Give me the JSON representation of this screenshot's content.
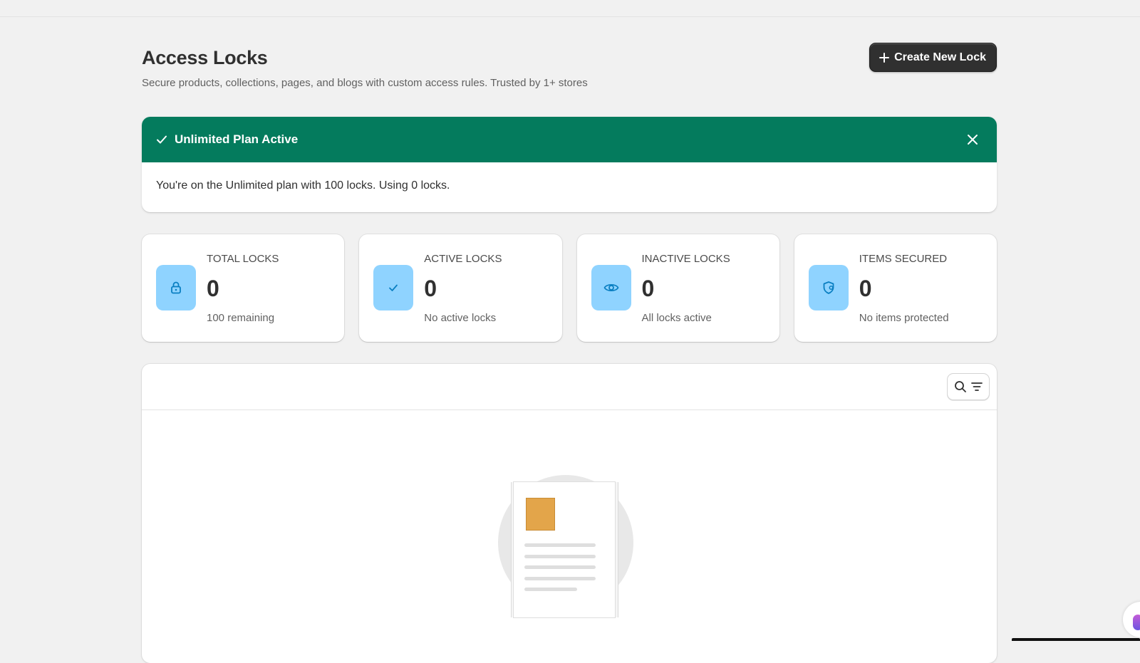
{
  "header": {
    "title": "Access Locks",
    "subtitle": "Secure products, collections, pages, and blogs with custom access rules. Trusted by 1+ stores",
    "create_button_label": "Create New Lock"
  },
  "banner": {
    "title": "Unlimited Plan Active",
    "message": "You're on the Unlimited plan with 100 locks. Using 0 locks.",
    "color": "#047b5d"
  },
  "stats": [
    {
      "label": "TOTAL LOCKS",
      "value": "0",
      "sub": "100 remaining",
      "icon": "lock-icon"
    },
    {
      "label": "ACTIVE LOCKS",
      "value": "0",
      "sub": "No active locks",
      "icon": "check-icon"
    },
    {
      "label": "INACTIVE LOCKS",
      "value": "0",
      "sub": "All locks active",
      "icon": "eye-icon"
    },
    {
      "label": "ITEMS SECURED",
      "value": "0",
      "sub": "No items protected",
      "icon": "shield-icon"
    }
  ],
  "colors": {
    "accent_icon_bg": "#8fd3ff",
    "icon_fg": "#0a7fc2",
    "primary_button": "#303030"
  },
  "table": {
    "toolbar_icons": [
      "search-icon",
      "filter-icon"
    ]
  }
}
